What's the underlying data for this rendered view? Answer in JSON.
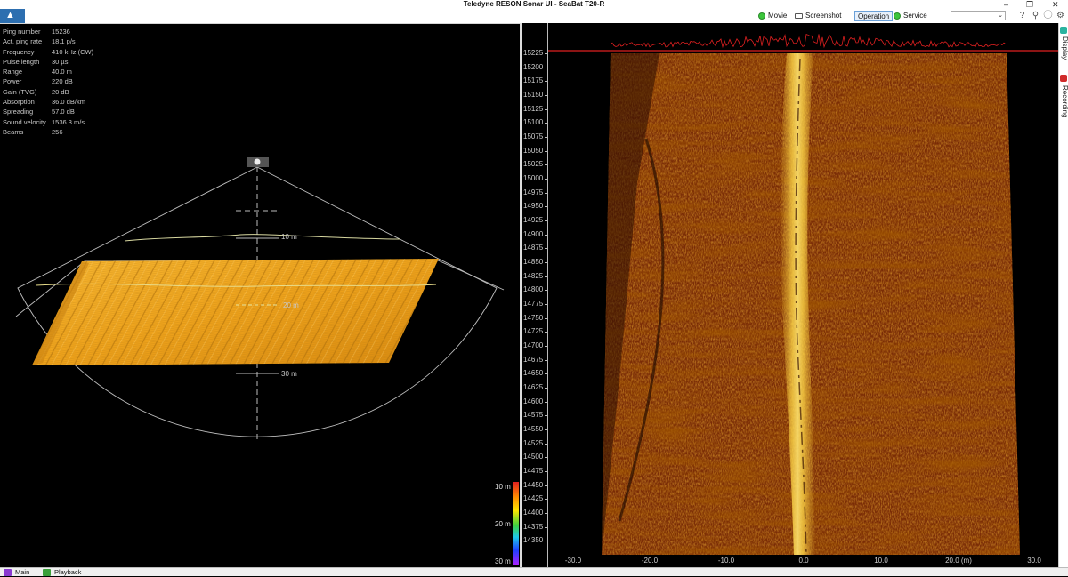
{
  "window": {
    "title": "Teledyne RESON Sonar UI - SeaBat T20-R",
    "controls": {
      "minimize": "–",
      "maximize": "❐",
      "close": "✕"
    }
  },
  "toolbar": {
    "movie_label": "Movie",
    "screenshot_label": "Screenshot",
    "operation_label": "Operation",
    "service_label": "Service",
    "status_color": "#3cc53c",
    "icons": [
      "help-icon",
      "search-icon",
      "info-icon",
      "gear-icon"
    ]
  },
  "info": [
    {
      "label": "Ping number",
      "value": "15236"
    },
    {
      "label": "Act. ping rate",
      "value": "18.1 p/s"
    },
    {
      "label": "Frequency",
      "value": "410 kHz (CW)"
    },
    {
      "label": "Pulse length",
      "value": "30 µs"
    },
    {
      "label": "Range",
      "value": "40.0 m"
    },
    {
      "label": "Power",
      "value": "220 dB"
    },
    {
      "label": "Gain (TVG)",
      "value": "20 dB"
    },
    {
      "label": "Absorption",
      "value": "36.0 dB/km"
    },
    {
      "label": "Spreading",
      "value": "57.0 dB"
    },
    {
      "label": "Sound velocity",
      "value": "1536.3 m/s"
    },
    {
      "label": "Beams",
      "value": "256"
    }
  ],
  "view3d": {
    "ranges": [
      "10 m",
      "20 m",
      "30 m"
    ],
    "surface_color": "#f0a020"
  },
  "colorscale": {
    "labels": [
      "10 m",
      "20 m",
      "30 m"
    ]
  },
  "waterfall": {
    "ping_ticks": [
      "15225",
      "15200",
      "15175",
      "15150",
      "15125",
      "15100",
      "15075",
      "15050",
      "15025",
      "15000",
      "14975",
      "14950",
      "14925",
      "14900",
      "14875",
      "14850",
      "14825",
      "14800",
      "14775",
      "14750",
      "14725",
      "14700",
      "14675",
      "14650",
      "14625",
      "14600",
      "14575",
      "14550",
      "14525",
      "14500",
      "14475",
      "14450",
      "14425",
      "14400",
      "14375",
      "14350"
    ],
    "x_ticks": [
      "-30.0",
      "-20.0",
      "-10.0",
      "0.0",
      "10.0",
      "20.0 (m)",
      "30.0"
    ],
    "signal_color": "#e02020"
  },
  "side_tabs": [
    "Display",
    "Recording"
  ],
  "status_tabs": [
    "Main",
    "Playback"
  ]
}
